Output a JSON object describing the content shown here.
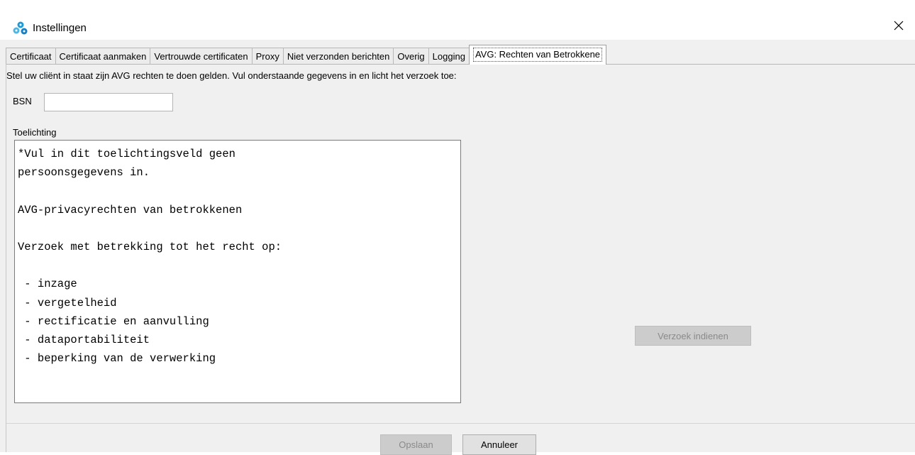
{
  "window": {
    "title": "Instellingen",
    "icon": "app-gears-icon",
    "close_icon": "close-icon"
  },
  "tabs": [
    {
      "label": "Certificaat",
      "active": false
    },
    {
      "label": "Certificaat aanmaken",
      "active": false
    },
    {
      "label": "Vertrouwde certificaten",
      "active": false
    },
    {
      "label": "Proxy",
      "active": false
    },
    {
      "label": "Niet verzonden berichten",
      "active": false
    },
    {
      "label": "Overig",
      "active": false
    },
    {
      "label": "Logging",
      "active": false
    },
    {
      "label": "AVG: Rechten van Betrokkene",
      "active": true
    }
  ],
  "form": {
    "instruction": "Stel uw cliënt in staat zijn AVG rechten te doen gelden. Vul onderstaande gegevens in en licht het verzoek toe:",
    "bsn_label": "BSN",
    "bsn_value": "",
    "toelichting_label": "Toelichting",
    "toelichting_value": "*Vul in dit toelichtingsveld geen\npersoonsgegevens in.\n\nAVG-privacyrechten van betrokkenen\n\nVerzoek met betrekking tot het recht op:\n\n - inzage\n - vergetelheid\n - rectificatie en aanvulling\n - dataportabiliteit\n - beperking van de verwerking",
    "submit_label": "Verzoek indienen"
  },
  "footer": {
    "save_label": "Opslaan",
    "cancel_label": "Annuleer"
  },
  "colors": {
    "window_bg": "#f0f0f0",
    "disabled_button_bg": "#cccccc",
    "disabled_text": "#8a8a8a",
    "icon_blue": "#1e9bd7"
  }
}
